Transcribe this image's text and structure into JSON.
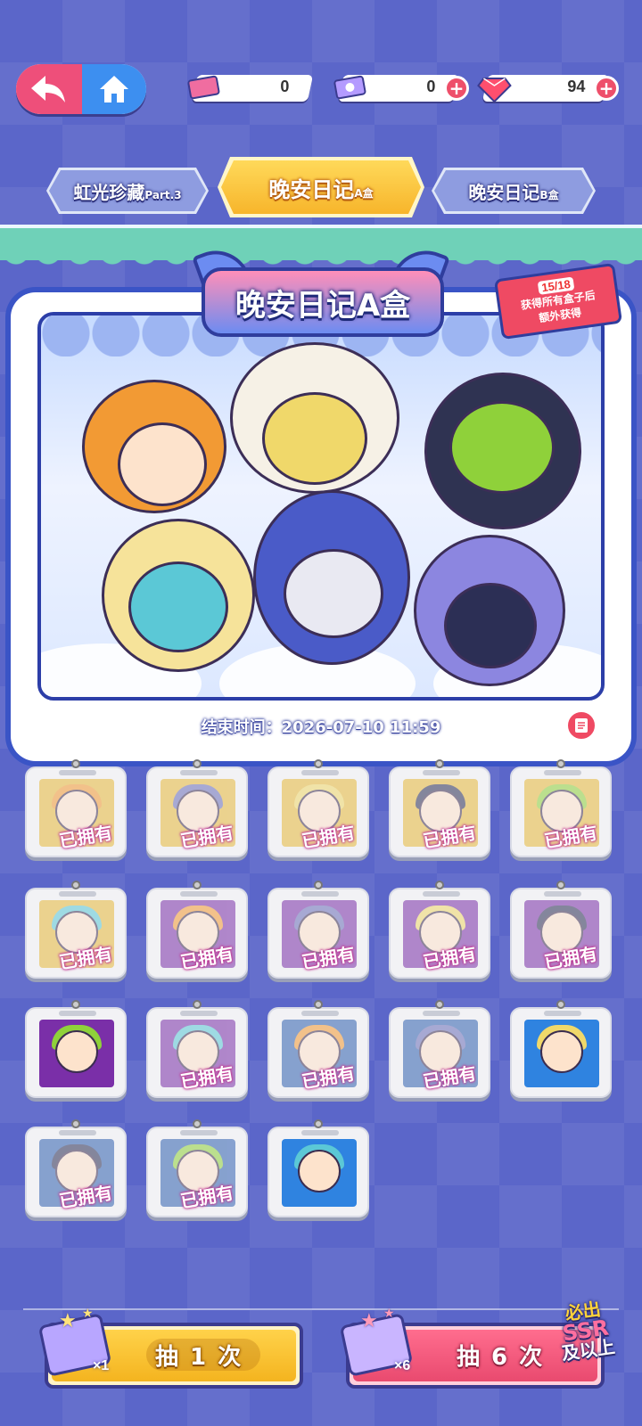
{
  "topbar": {
    "currencies": [
      {
        "icon": "ticket-pink-icon",
        "value": "0",
        "has_plus": false
      },
      {
        "icon": "ticket-purple-icon",
        "value": "0",
        "has_plus": true
      },
      {
        "icon": "gem-icon",
        "value": "94",
        "has_plus": true
      }
    ]
  },
  "tabs": [
    {
      "label": "虹光珍藏",
      "suffix": "Part.3",
      "active": false
    },
    {
      "label": "晚安日记",
      "suffix": "A盒",
      "active": true
    },
    {
      "label": "晚安日记",
      "suffix": "B盒",
      "active": false
    }
  ],
  "banner": {
    "title": "晚安日记A盒",
    "bonus_count": "15/18",
    "bonus_line1": "获得所有盒子后",
    "bonus_line2": "额外获得",
    "end_time": "结束时间：2026-07-10 11:59"
  },
  "collection": {
    "owned_label": "已拥有",
    "items": [
      {
        "bg": "#e6b83a",
        "hair": "#f29a34",
        "owned": true
      },
      {
        "bg": "#e6b83a",
        "hair": "#6b6fb8",
        "owned": true
      },
      {
        "bg": "#e6b83a",
        "hair": "#f0d86a",
        "owned": true
      },
      {
        "bg": "#e6b83a",
        "hair": "#2c2f55",
        "owned": true
      },
      {
        "bg": "#e6b83a",
        "hair": "#8fd13a",
        "owned": true
      },
      {
        "bg": "#e6b83a",
        "hair": "#5bc8d6",
        "owned": true
      },
      {
        "bg": "#7a2fa8",
        "hair": "#f29a34",
        "owned": true
      },
      {
        "bg": "#7a2fa8",
        "hair": "#6b6fb8",
        "owned": true
      },
      {
        "bg": "#7a2fa8",
        "hair": "#f0d86a",
        "owned": true
      },
      {
        "bg": "#7a2fa8",
        "hair": "#2c2f55",
        "owned": true
      },
      {
        "bg": "#7a2fa8",
        "hair": "#8fd13a",
        "owned": false
      },
      {
        "bg": "#7a2fa8",
        "hair": "#5bc8d6",
        "owned": true
      },
      {
        "bg": "#2f5fb0",
        "hair": "#f29a34",
        "owned": true
      },
      {
        "bg": "#2f5fb0",
        "hair": "#6b6fb8",
        "owned": true
      },
      {
        "bg": "#2f83e0",
        "hair": "#f0d86a",
        "owned": false
      },
      {
        "bg": "#2f5fb0",
        "hair": "#2c2f55",
        "owned": true
      },
      {
        "bg": "#2f5fb0",
        "hair": "#8fd13a",
        "owned": true
      },
      {
        "bg": "#2f83e0",
        "hair": "#5bc8d6",
        "owned": false
      }
    ]
  },
  "draw": {
    "single_label": "抽 1 次",
    "single_mult": "×1",
    "multi_label": "抽 6 次",
    "multi_mult": "×6",
    "ssr_line1": "必出",
    "ssr_line2": "SSR",
    "ssr_line3": "及以上"
  },
  "colors": {
    "accent_pink": "#ee4f7a",
    "accent_blue": "#3d8ff0",
    "gold": "#f7b52b"
  }
}
